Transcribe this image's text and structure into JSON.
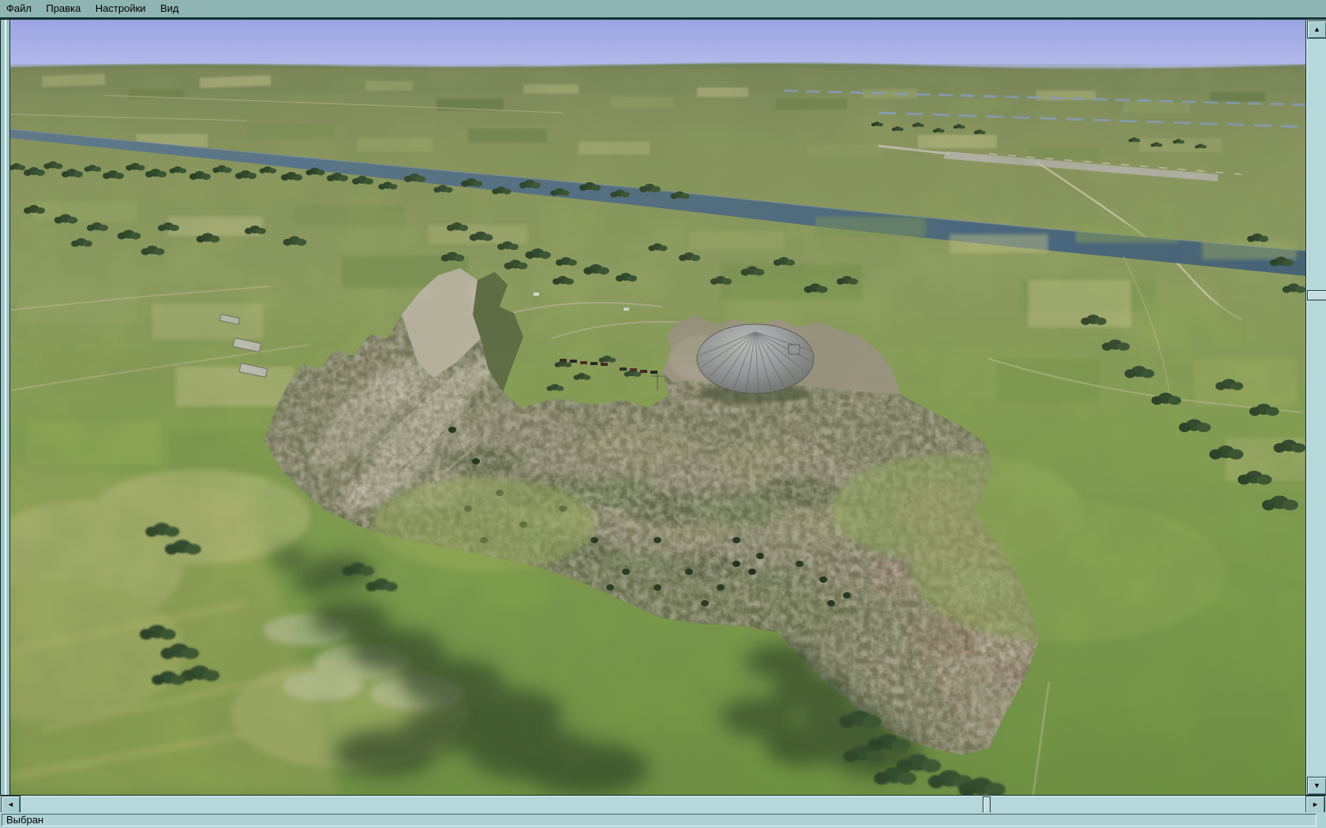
{
  "menu": {
    "items": [
      {
        "label": "Файл"
      },
      {
        "label": "Правка"
      },
      {
        "label": "Настройки"
      },
      {
        "label": "Вид"
      }
    ]
  },
  "statusbar": {
    "text": "Выбран"
  },
  "scrollbars": {
    "up": "▲",
    "down": "▼",
    "left": "◄",
    "right": "►"
  },
  "colors": {
    "menubar_bg": "#8FB5B3",
    "chrome_light": "#B6D8DB",
    "status_bg": "#AFD2D4",
    "sky": "#A1A9E4",
    "river": "#4E6A88",
    "field_green": "#84A050",
    "mountain_body": "#7E7A5F",
    "dome_gray": "#97979D"
  },
  "scene": {
    "description": "3D aerial terrain view: patchwork farmland river valley, airfield at upper right, selected mountainous terrain patch with radar dome and train convoy in the center",
    "selected_object": "mountain terrain patch",
    "features": [
      "sky",
      "river",
      "canal",
      "airfield-runway",
      "radar-dome",
      "train-convoy",
      "barracks",
      "tree-clusters",
      "field-patchwork"
    ]
  }
}
